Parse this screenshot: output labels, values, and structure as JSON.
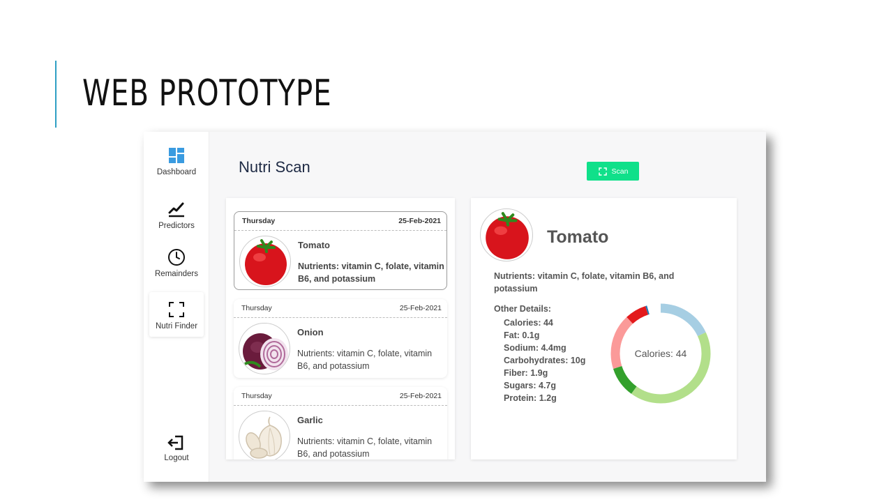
{
  "slide": {
    "title": "WEB PROTOTYPE",
    "accent_color": "#2e9fc4"
  },
  "sidebar": {
    "items": [
      {
        "label": "Dashboard",
        "icon": "dashboard-icon"
      },
      {
        "label": "Predictors",
        "icon": "chart-line-icon"
      },
      {
        "label": "Remainders",
        "icon": "clock-icon"
      },
      {
        "label": "Nutri Finder",
        "icon": "scan-frame-icon",
        "active": true
      }
    ],
    "logout": {
      "label": "Logout",
      "icon": "logout-icon"
    }
  },
  "header": {
    "title": "Nutri Scan",
    "scan_button": {
      "label": "Scan",
      "icon": "scan-frame-icon",
      "color": "#10e08a"
    }
  },
  "history": [
    {
      "day": "Thursday",
      "date": "25-Feb-2021",
      "name": "Tomato",
      "nutrients": "Nutrients: vitamin C, folate, vitamin B6, and potassium",
      "image": "tomato",
      "selected": true
    },
    {
      "day": "Thursday",
      "date": "25-Feb-2021",
      "name": "Onion",
      "nutrients": "Nutrients: vitamin C, folate, vitamin B6, and potassium",
      "image": "onion"
    },
    {
      "day": "Thursday",
      "date": "25-Feb-2021",
      "name": "Garlic",
      "nutrients": "Nutrients: vitamin C, folate, vitamin B6, and potassium",
      "image": "garlic"
    }
  ],
  "detail": {
    "name": "Tomato",
    "nutrients": "Nutrients: vitamin C, folate, vitamin B6, and potassium",
    "other_title": "Other Details:",
    "stats": [
      "Calories: 44",
      "Fat: 0.1g",
      "Sodium: 4.4mg",
      "Carbohydrates: 10g",
      "Fiber: 1.9g",
      "Sugars: 4.7g",
      "Protein: 1.2g"
    ],
    "donut_center": "Calories: 44",
    "donut_segments": [
      {
        "color": "#a6cee3",
        "fraction": 0.18
      },
      {
        "color": "#b2df8a",
        "fraction": 0.42
      },
      {
        "color": "#33a02c",
        "fraction": 0.1
      },
      {
        "color": "#fb9a99",
        "fraction": 0.18
      },
      {
        "color": "#e31a1c",
        "fraction": 0.07
      },
      {
        "color": "#1f78b4",
        "fraction": 0.005
      }
    ]
  }
}
